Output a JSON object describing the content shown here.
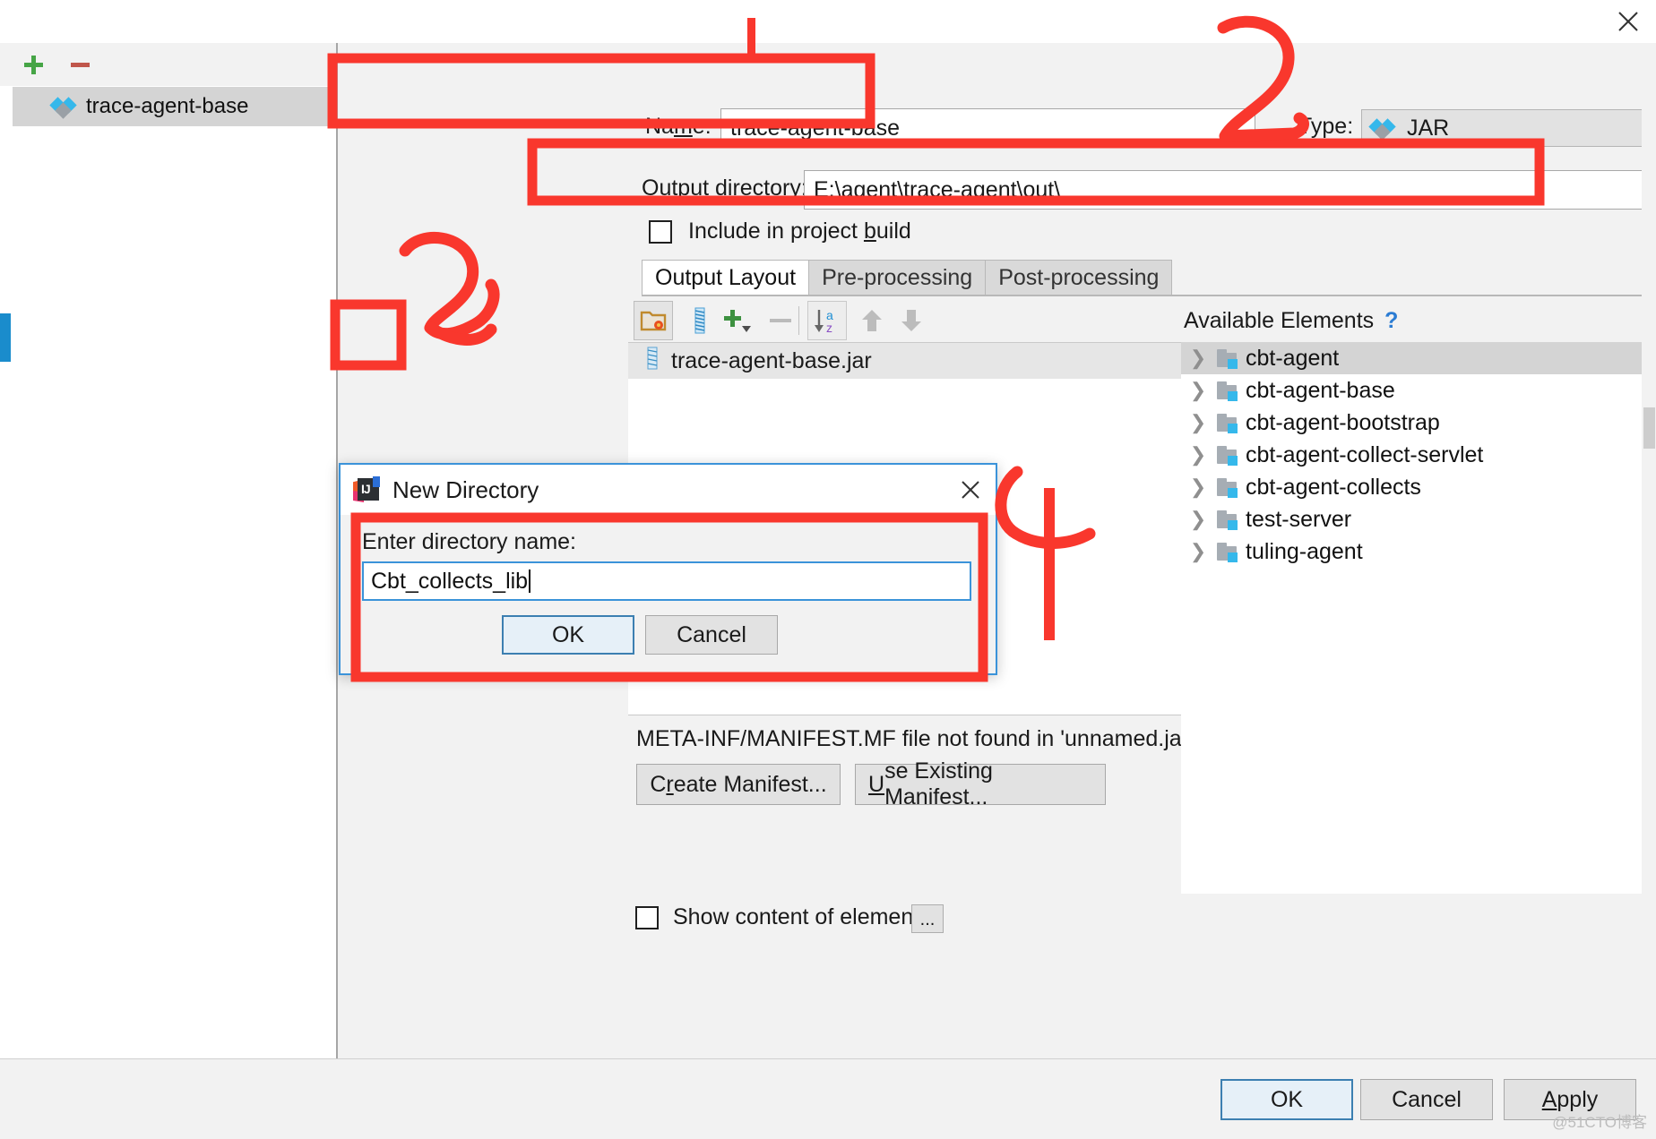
{
  "window": {
    "close_icon": "close-icon"
  },
  "sidebar": {
    "add_label": "+",
    "remove_label": "−",
    "items": [
      {
        "label": "trace-agent-base",
        "icon": "artifact-diamond-icon",
        "selected": true
      }
    ]
  },
  "form": {
    "name_label_pre": "Na",
    "name_label_mn": "m",
    "name_label_post": "e:",
    "name_value": "trace-agent-base",
    "type_label": "Type:",
    "type_value": "JAR",
    "type_icon": "artifact-diamond-icon",
    "outdir_label": "Output directory:",
    "outdir_value": "E:\\agent\\trace-agent\\out\\",
    "outdir_browse_label": "...",
    "include_label_pre": "Include in project ",
    "include_label_mn": "b",
    "include_label_post": "uild",
    "include_checked": false
  },
  "tabs": [
    {
      "label": "Output Layout",
      "active": true
    },
    {
      "label": "Pre-processing",
      "active": false
    },
    {
      "label": "Post-processing",
      "active": false
    }
  ],
  "layout_toolbar": [
    {
      "name": "new-directory-button",
      "icon": "folder-new-icon",
      "highlighted": true
    },
    {
      "name": "extract-into-output-button",
      "icon": "archive-icon"
    },
    {
      "name": "add-copy-of-button",
      "icon": "plus-dropdown-icon"
    },
    {
      "name": "remove-button",
      "icon": "minus-icon"
    },
    {
      "name": "sort-button",
      "icon": "sort-az-icon"
    },
    {
      "name": "move-up-button",
      "icon": "arrow-up-icon"
    },
    {
      "name": "move-down-button",
      "icon": "arrow-down-icon"
    }
  ],
  "output_layout": {
    "rows": [
      {
        "label": "trace-agent-base.jar",
        "icon": "jar-icon",
        "selected": true
      }
    ]
  },
  "manifest": {
    "message": "META-INF/MANIFEST.MF file not found in 'unnamed.jar'",
    "create_pre": "C",
    "create_mn": "r",
    "create_post": "eate Manifest...",
    "use_pre": "",
    "use_mn": "U",
    "use_post": "se Existing Manifest..."
  },
  "show_content": {
    "label": "Show content of elements",
    "checked": false,
    "more_label": "..."
  },
  "available": {
    "title": "Available Elements",
    "help_label": "?",
    "items": [
      {
        "label": "cbt-agent",
        "icon": "module-icon",
        "selected": true
      },
      {
        "label": "cbt-agent-base",
        "icon": "module-icon",
        "selected": false
      },
      {
        "label": "cbt-agent-bootstrap",
        "icon": "module-icon",
        "selected": false
      },
      {
        "label": "cbt-agent-collect-servlet",
        "icon": "module-icon",
        "selected": false
      },
      {
        "label": "cbt-agent-collects",
        "icon": "module-icon",
        "selected": false
      },
      {
        "label": "test-server",
        "icon": "module-icon",
        "selected": false
      },
      {
        "label": "tuling-agent",
        "icon": "module-icon",
        "selected": false
      }
    ]
  },
  "new_directory_dialog": {
    "title": "New Directory",
    "app_icon": "intellij-idea-icon",
    "close_icon": "close-icon",
    "prompt": "Enter directory name:",
    "input_value": "Cbt_collects_lib",
    "ok_label": "OK",
    "cancel_label": "Cancel"
  },
  "footer": {
    "ok_label": "OK",
    "cancel_label": "Cancel",
    "apply_pre": "",
    "apply_mn": "A",
    "apply_post": "pply"
  },
  "watermark": "@51CTO博客",
  "colors": {
    "annotation": "#f9372d",
    "accent_blue": "#3b93d9",
    "icon_cyan": "#35b8eb",
    "selection_gray": "#d4d4d4"
  }
}
